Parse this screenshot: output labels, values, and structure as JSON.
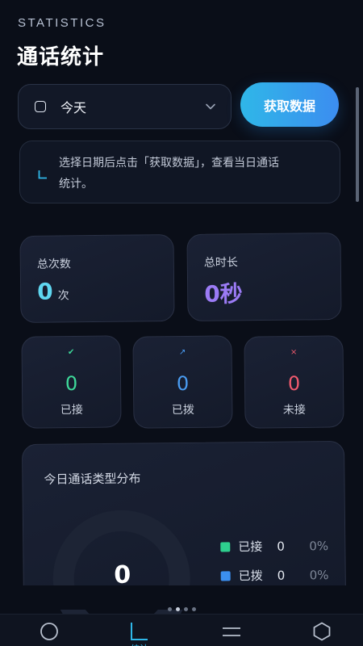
{
  "header": {
    "kicker": "STATISTICS",
    "title": "通话统计"
  },
  "date_select": {
    "value": "今天",
    "icon": "calendar-icon"
  },
  "fetch_button": {
    "label": "获取数据"
  },
  "hint": {
    "line1": "选择日期后点击「获取数据」，查看当日通话",
    "line2": "统计。"
  },
  "summary": {
    "total_count": {
      "label": "总次数",
      "value": "0",
      "unit": "次",
      "color": "#5fd6f0"
    },
    "total_duration": {
      "label": "总时长",
      "value": "0秒",
      "color": "#9b7bf5"
    }
  },
  "breakdown": [
    {
      "label": "已接",
      "value": "0",
      "icon": "✔",
      "color": "#3ed99a"
    },
    {
      "label": "已拨",
      "value": "0",
      "icon": "↗",
      "color": "#4a9cf2"
    },
    {
      "label": "未接",
      "value": "0",
      "icon": "×",
      "color": "#f05a6e"
    }
  ],
  "distribution": {
    "title": "今日通话类型分布",
    "center_value": "0",
    "legend": [
      {
        "name": "已接",
        "value": "0",
        "percent": "0%",
        "color": "#2ecf8e"
      },
      {
        "name": "已拨",
        "value": "0",
        "percent": "0%",
        "color": "#3b8ff0"
      }
    ]
  },
  "tabs": [
    {
      "icon": "circle-icon"
    },
    {
      "icon": "chart-icon",
      "label": "统计"
    },
    {
      "icon": "menu-icon"
    },
    {
      "icon": "hexagon-icon"
    }
  ]
}
